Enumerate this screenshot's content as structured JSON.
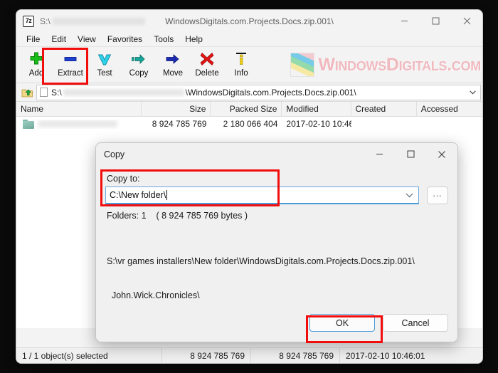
{
  "window": {
    "app_icon": "7z-icon",
    "path_prefix": "S:\\",
    "title": "WindowsDigitals.com.Projects.Docs.zip.001\\",
    "controls": {
      "minimize": "minimize-icon",
      "maximize": "maximize-icon",
      "close": "close-icon"
    }
  },
  "menu": {
    "items": [
      {
        "label": "File"
      },
      {
        "label": "Edit"
      },
      {
        "label": "View"
      },
      {
        "label": "Favorites"
      },
      {
        "label": "Tools"
      },
      {
        "label": "Help"
      }
    ]
  },
  "toolbar": {
    "buttons": [
      {
        "label": "Add",
        "icon": "plus-icon"
      },
      {
        "label": "Extract",
        "icon": "minus-bar-icon"
      },
      {
        "label": "Test",
        "icon": "checkmark-icon"
      },
      {
        "label": "Copy",
        "icon": "arrow-right-dashed-icon"
      },
      {
        "label": "Move",
        "icon": "arrow-right-icon"
      },
      {
        "label": "Delete",
        "icon": "x-cross-icon"
      },
      {
        "label": "Info",
        "icon": "info-i-icon"
      }
    ]
  },
  "watermark": {
    "text": "WindowsDigitals.com",
    "logo": "colorful-square-logo",
    "color": "#f0b6bd"
  },
  "address_bar": {
    "up_button": "up-folder-icon",
    "path_prefix": "S:\\",
    "path_suffix": "\\WindowsDigitals.com.Projects.Docs.zip.001\\",
    "dropdown": "chevron-down-icon"
  },
  "file_list": {
    "columns": [
      "Name",
      "Size",
      "Packed Size",
      "Modified",
      "Created",
      "Accessed"
    ],
    "rows": [
      {
        "name": "",
        "size": "8 924 785 769",
        "packed_size": "2 180 066 404",
        "modified": "2017-02-10 10:46",
        "created": "",
        "accessed": "",
        "icon": "folder-icon"
      }
    ]
  },
  "status_bar": {
    "selection": "1 / 1 object(s) selected",
    "size": "8 924 785 769",
    "packed_size": "8 924 785 769",
    "modified": "2017-02-10 10:46:01"
  },
  "dialog": {
    "title": "Copy",
    "controls": {
      "minimize": "minimize-icon",
      "maximize": "maximize-icon",
      "close": "close-icon"
    },
    "copy_to_label": "Copy to:",
    "copy_to_value": "C:\\New folder\\",
    "copy_to_placeholder": "",
    "browse_label": "...",
    "dropdown": "chevron-down-icon",
    "folders_info": "Folders: 1    ( 8 924 785 769 bytes )",
    "source_path_line1": "S:\\vr games installers\\New folder\\WindowsDigitals.com.Projects.Docs.zip.001\\",
    "source_path_line2": "  John.Wick.Chronicles\\",
    "ok_label": "OK",
    "cancel_label": "Cancel"
  },
  "annotations": {
    "highlight_color": "#f20d0d",
    "boxes": [
      "extract-toolbar-button",
      "copy-to-field",
      "ok-button"
    ]
  }
}
